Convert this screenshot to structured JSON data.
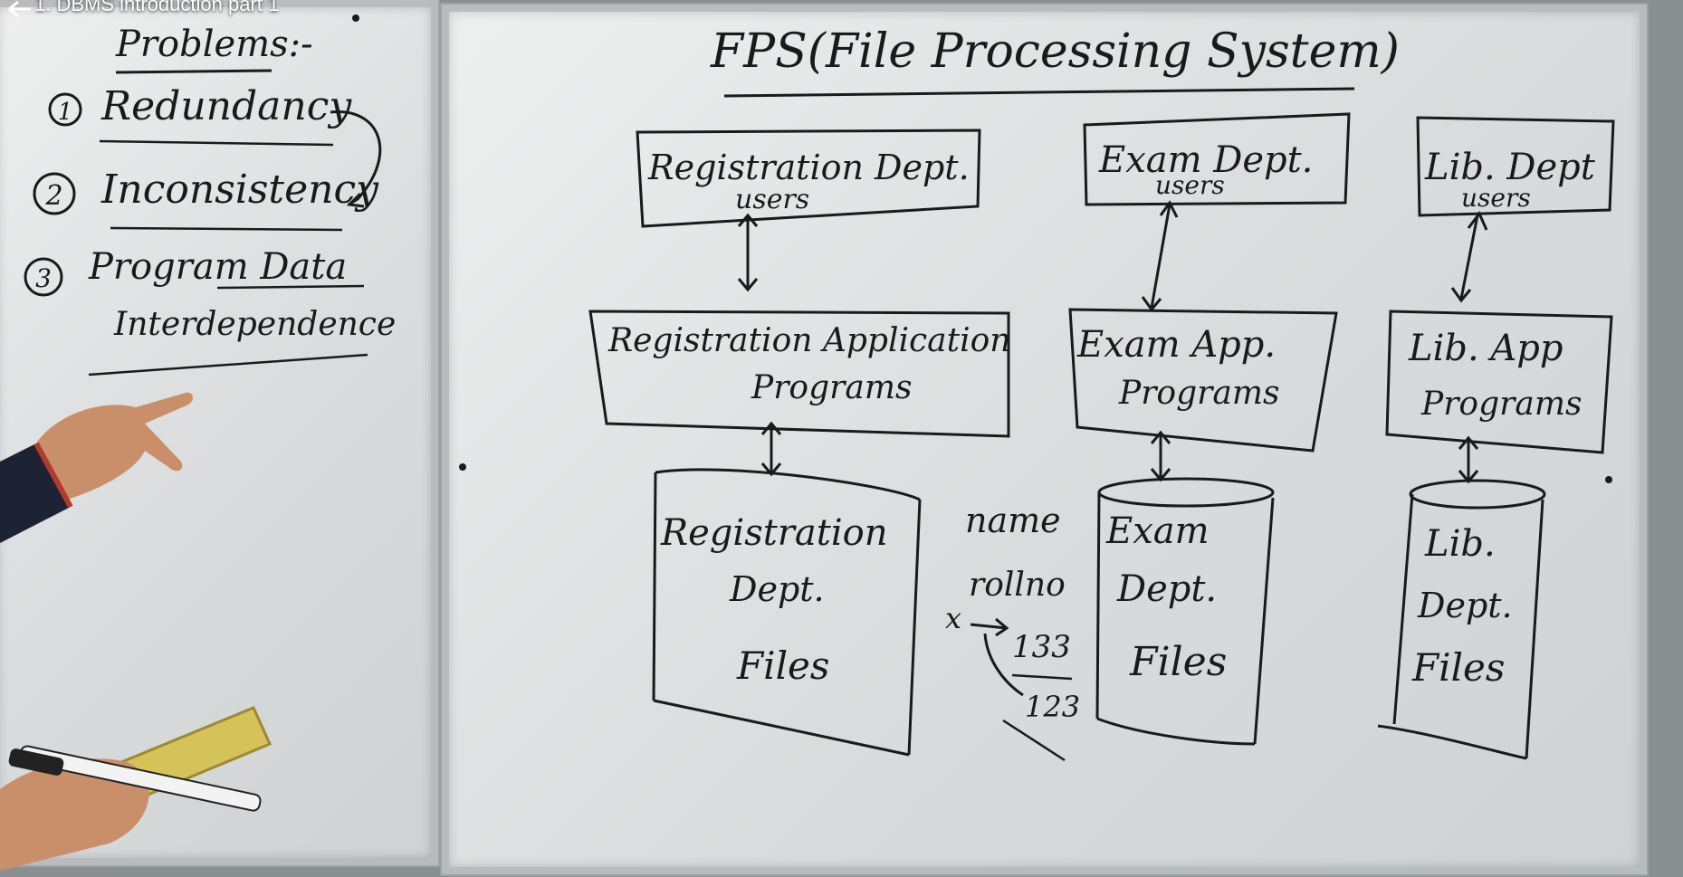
{
  "video": {
    "title": "1. DBMS introduction part 1"
  },
  "left_board": {
    "heading": "Problems:-",
    "items": [
      {
        "number": "1",
        "text": "Redundancy"
      },
      {
        "number": "2",
        "text": "Inconsistency"
      },
      {
        "number": "3",
        "text_line1": "Program Data",
        "text_line2": "Interdependence"
      }
    ]
  },
  "right_board": {
    "title": "FPS(File Processing System)",
    "columns": [
      {
        "user_box": {
          "line1": "Registration Dept.",
          "line2": "users"
        },
        "app_box": {
          "line1": "Registration Application",
          "line2": "Programs"
        },
        "files": {
          "line1": "Registration",
          "line2": "Dept.",
          "line3": "Files"
        }
      },
      {
        "user_box": {
          "line1": "Exam Dept.",
          "line2": "users"
        },
        "app_box": {
          "line1": "Exam App.",
          "line2": "Programs"
        },
        "files": {
          "line1": "Exam",
          "line2": "Dept.",
          "line3": "Files"
        }
      },
      {
        "user_box": {
          "line1": "Lib. Dept",
          "line2": "users"
        },
        "app_box": {
          "line1": "Lib. App",
          "line2": "Programs"
        },
        "files": {
          "line1": "Lib.",
          "line2": "Dept.",
          "line3": "Files"
        }
      }
    ],
    "notes": {
      "name": "name",
      "rollno": "rollno",
      "x": "x",
      "v1": "133",
      "v2": "123"
    }
  }
}
